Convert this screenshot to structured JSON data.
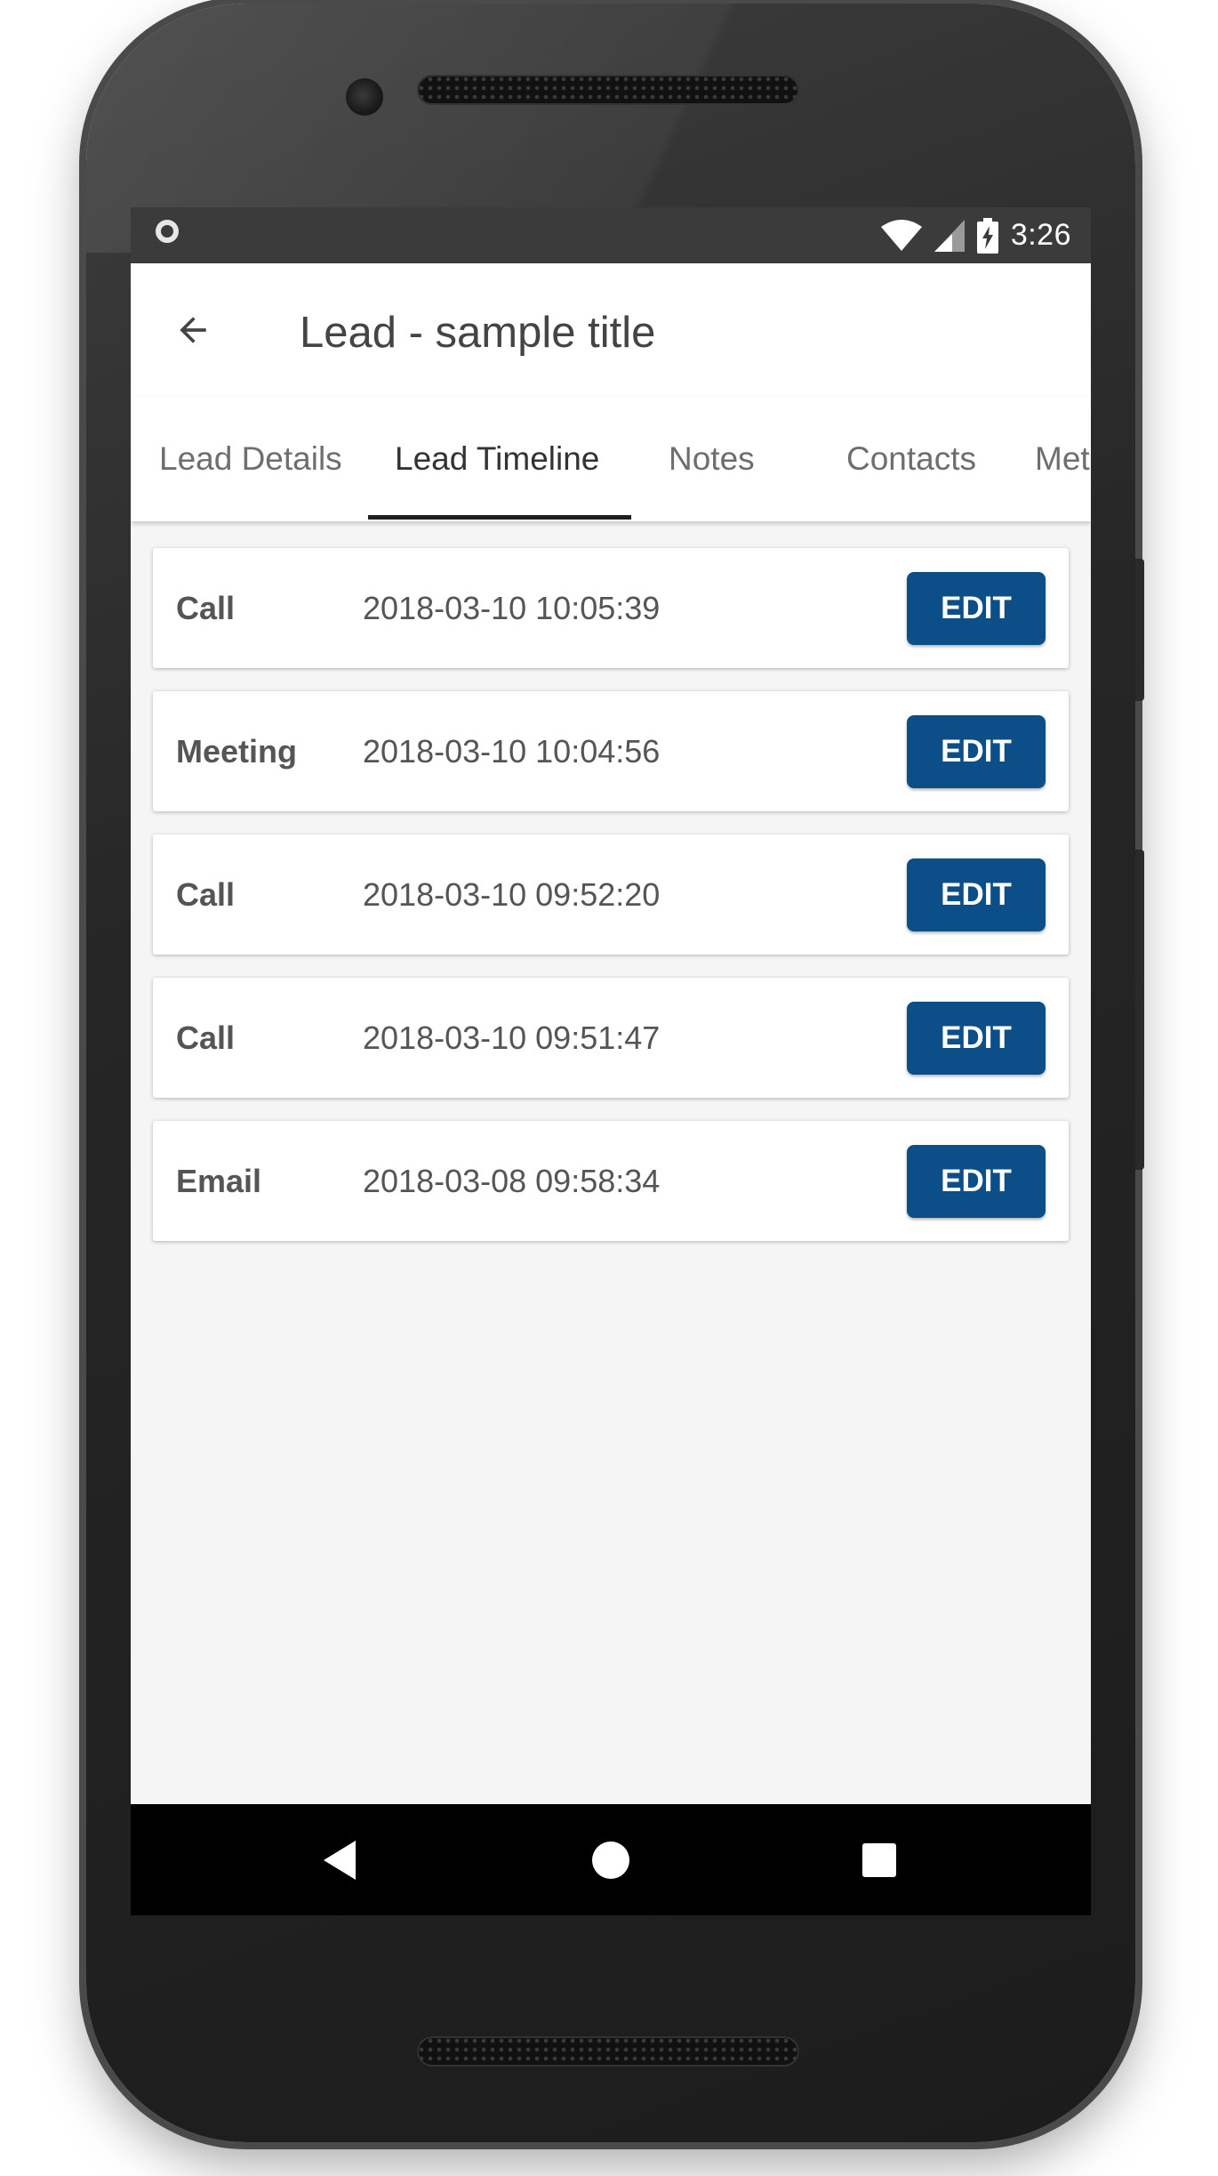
{
  "status_bar": {
    "time": "3:26"
  },
  "app_bar": {
    "title": "Lead - sample title"
  },
  "tabs": [
    {
      "label": "Lead Details",
      "active": false
    },
    {
      "label": "Lead Timeline",
      "active": true
    },
    {
      "label": "Notes",
      "active": false
    },
    {
      "label": "Contacts",
      "active": false
    },
    {
      "label": "Meta",
      "active": false
    }
  ],
  "timeline": [
    {
      "type": "Call",
      "datetime": "2018-03-10 10:05:39",
      "action": "EDIT"
    },
    {
      "type": "Meeting",
      "datetime": "2018-03-10 10:04:56",
      "action": "EDIT"
    },
    {
      "type": "Call",
      "datetime": "2018-03-10 09:52:20",
      "action": "EDIT"
    },
    {
      "type": "Call",
      "datetime": "2018-03-10 09:51:47",
      "action": "EDIT"
    },
    {
      "type": "Email",
      "datetime": "2018-03-08 09:58:34",
      "action": "EDIT"
    }
  ],
  "icons": {
    "status_left": "notification-ring-icon",
    "wifi": "wifi-icon",
    "signal": "cell-signal-icon",
    "battery": "battery-charging-icon",
    "back": "arrow-back-icon",
    "nav_back": "nav-back-icon",
    "nav_home": "nav-home-icon",
    "nav_recents": "nav-recents-icon"
  },
  "colors": {
    "accent": "#0c4e87",
    "status_bar": "#3b3b3b",
    "background": "#f5f5f5",
    "tab_indicator": "#1f1f1f"
  }
}
